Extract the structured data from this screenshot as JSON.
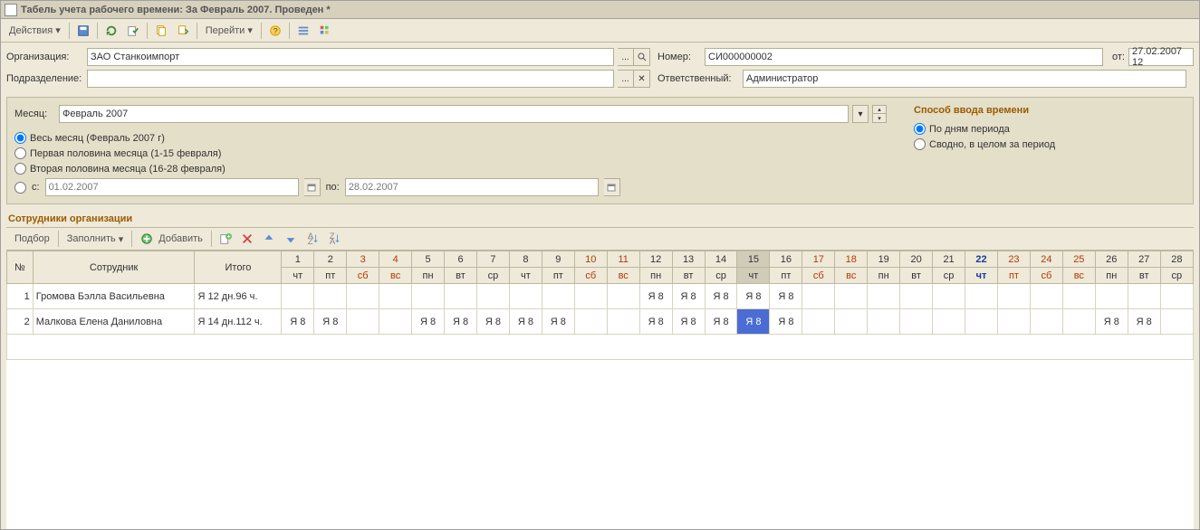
{
  "title": "Табель учета рабочего времени: За Февраль 2007. Проведен *",
  "toolbar": {
    "actions": "Действия",
    "go": "Перейти"
  },
  "form": {
    "org_label": "Организация:",
    "org_value": "ЗАО Станкоимпорт",
    "dept_label": "Подразделение:",
    "dept_value": "",
    "number_label": "Номер:",
    "number_value": "СИ000000002",
    "from_label": "от:",
    "from_value": "27.02.2007 12",
    "resp_label": "Ответственный:",
    "resp_value": "Администратор"
  },
  "month": {
    "label": "Месяц:",
    "value": "Февраль 2007"
  },
  "period": {
    "whole": "Весь месяц (Февраль 2007 г)",
    "first_half": "Первая половина месяца (1-15 февраля)",
    "second_half": "Вторая половина месяца (16-28 февраля)",
    "from_label": "с:",
    "from_value": "01.02.2007",
    "to_label": "по:",
    "to_value": "28.02.2007"
  },
  "mode": {
    "title": "Способ ввода времени",
    "by_days": "По дням периода",
    "summary": "Сводно, в целом за период"
  },
  "employees_title": "Сотрудники организации",
  "grid_toolbar": {
    "select": "Подбор",
    "fill": "Заполнить",
    "add": "Добавить"
  },
  "columns": {
    "num": "№",
    "emp": "Сотрудник",
    "sum": "Итого"
  },
  "days": [
    {
      "n": "1",
      "wd": "чт",
      "w": false,
      "now": false,
      "today": false
    },
    {
      "n": "2",
      "wd": "пт",
      "w": false,
      "now": false,
      "today": false
    },
    {
      "n": "3",
      "wd": "сб",
      "w": true,
      "now": false,
      "today": false
    },
    {
      "n": "4",
      "wd": "вс",
      "w": true,
      "now": false,
      "today": false
    },
    {
      "n": "5",
      "wd": "пн",
      "w": false,
      "now": false,
      "today": false
    },
    {
      "n": "6",
      "wd": "вт",
      "w": false,
      "now": false,
      "today": false
    },
    {
      "n": "7",
      "wd": "ср",
      "w": false,
      "now": false,
      "today": false
    },
    {
      "n": "8",
      "wd": "чт",
      "w": false,
      "now": false,
      "today": false
    },
    {
      "n": "9",
      "wd": "пт",
      "w": false,
      "now": false,
      "today": false
    },
    {
      "n": "10",
      "wd": "сб",
      "w": true,
      "now": false,
      "today": false
    },
    {
      "n": "11",
      "wd": "вс",
      "w": true,
      "now": false,
      "today": false
    },
    {
      "n": "12",
      "wd": "пн",
      "w": false,
      "now": false,
      "today": false
    },
    {
      "n": "13",
      "wd": "вт",
      "w": false,
      "now": false,
      "today": false
    },
    {
      "n": "14",
      "wd": "ср",
      "w": false,
      "now": false,
      "today": false
    },
    {
      "n": "15",
      "wd": "чт",
      "w": false,
      "now": true,
      "today": false
    },
    {
      "n": "16",
      "wd": "пт",
      "w": false,
      "now": false,
      "today": false
    },
    {
      "n": "17",
      "wd": "сб",
      "w": true,
      "now": false,
      "today": false
    },
    {
      "n": "18",
      "wd": "вс",
      "w": true,
      "now": false,
      "today": false
    },
    {
      "n": "19",
      "wd": "пн",
      "w": false,
      "now": false,
      "today": false
    },
    {
      "n": "20",
      "wd": "вт",
      "w": false,
      "now": false,
      "today": false
    },
    {
      "n": "21",
      "wd": "ср",
      "w": false,
      "now": false,
      "today": false
    },
    {
      "n": "22",
      "wd": "чт",
      "w": false,
      "now": false,
      "today": true
    },
    {
      "n": "23",
      "wd": "пт",
      "w": true,
      "now": false,
      "today": false
    },
    {
      "n": "24",
      "wd": "сб",
      "w": true,
      "now": false,
      "today": false
    },
    {
      "n": "25",
      "wd": "вс",
      "w": true,
      "now": false,
      "today": false
    },
    {
      "n": "26",
      "wd": "пн",
      "w": false,
      "now": false,
      "today": false
    },
    {
      "n": "27",
      "wd": "вт",
      "w": false,
      "now": false,
      "today": false
    },
    {
      "n": "28",
      "wd": "ср",
      "w": false,
      "now": false,
      "today": false
    }
  ],
  "rows": [
    {
      "n": "1",
      "name": "Громова Бэлла Васильевна",
      "sum": "Я 12 дн.96 ч.",
      "cells": [
        "",
        "",
        "",
        "",
        "",
        "",
        "",
        "",
        "",
        "",
        "",
        "Я 8",
        "Я 8",
        "Я 8",
        "Я 8",
        "Я 8",
        "",
        "",
        "",
        "",
        "",
        "",
        "",
        "",
        "",
        "",
        "",
        ""
      ]
    },
    {
      "n": "2",
      "name": "Малкова Елена Даниловна",
      "sum": "Я 14 дн.112 ч.",
      "cells": [
        "Я 8",
        "Я 8",
        "",
        "",
        "Я 8",
        "Я 8",
        "Я 8",
        "Я 8",
        "Я 8",
        "",
        "",
        "Я 8",
        "Я 8",
        "Я 8",
        "Я 8",
        "Я 8",
        "",
        "",
        "",
        "",
        "",
        "",
        "",
        "",
        "",
        "Я 8",
        "Я 8",
        ""
      ]
    }
  ],
  "selected_cell": {
    "row": 1,
    "col": 14
  }
}
